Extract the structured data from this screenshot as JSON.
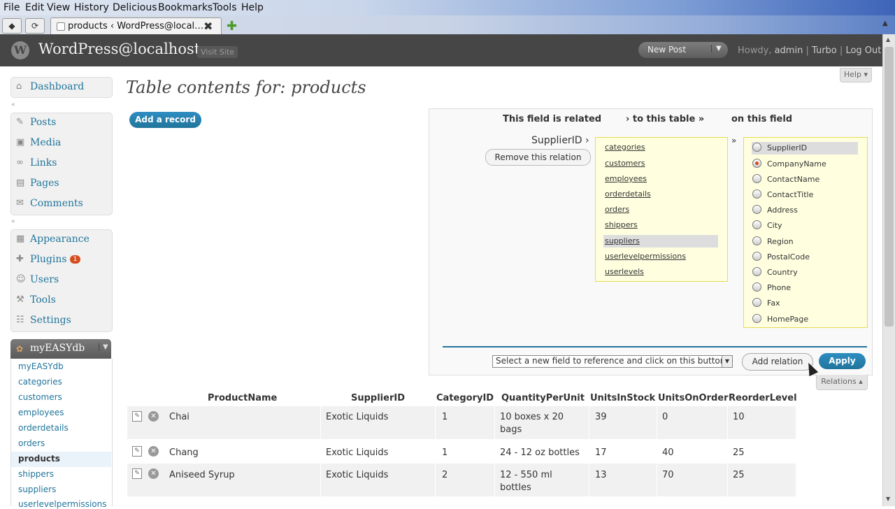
{
  "browser": {
    "menu": [
      "File",
      "Edit",
      "View",
      "History",
      "Delicious",
      "Bookmarks",
      "Tools",
      "Help"
    ],
    "tab_title": "products ‹ WordPress@local…",
    "tab_close": "✖",
    "new_tab": "✚"
  },
  "wp_header": {
    "site_title": "WordPress@localhost",
    "visit_site": "Visit Site",
    "new_post": "New Post",
    "howdy": "Howdy,",
    "user": "admin",
    "turbo": "Turbo",
    "logout": "Log Out",
    "sep": "|"
  },
  "help_label": "Help ▾",
  "sidebar": {
    "dashboard": "Dashboard",
    "posts": "Posts",
    "media": "Media",
    "links": "Links",
    "pages": "Pages",
    "comments": "Comments",
    "appearance": "Appearance",
    "plugins": "Plugins",
    "plugins_badge": "1",
    "users": "Users",
    "tools": "Tools",
    "settings": "Settings",
    "easy_title": "myEASYdb",
    "easy_items": [
      "myEASYdb",
      "categories",
      "customers",
      "employees",
      "orderdetails",
      "orders",
      "products",
      "shippers",
      "suppliers",
      "userlevelpermissions"
    ]
  },
  "main": {
    "title": "Table contents for: products",
    "add_record": "Add a record"
  },
  "relations": {
    "hdr_field": "This field is related",
    "hdr_table": "› to this table »",
    "hdr_on": "on this field",
    "field": "SupplierID ›",
    "remove": "Remove this relation",
    "arrow": "»",
    "tables": [
      "categories",
      "customers",
      "employees",
      "orderdetails",
      "orders",
      "shippers",
      "suppliers",
      "userlevelpermissions",
      "userlevels"
    ],
    "selected_table": "suppliers",
    "fields": [
      "SupplierID",
      "CompanyName",
      "ContactName",
      "ContactTitle",
      "Address",
      "City",
      "Region",
      "PostalCode",
      "Country",
      "Phone",
      "Fax",
      "HomePage"
    ],
    "selected_field": "CompanyName",
    "new_field_select": "Select a new field to reference and click on this button »",
    "add_relation": "Add relation",
    "apply": "Apply",
    "relations_toggle": "Relations ▴"
  },
  "table": {
    "columns": [
      "ProductName",
      "SupplierID",
      "CategoryID",
      "QuantityPerUnit",
      "UnitsInStock",
      "UnitsOnOrder",
      "ReorderLevel"
    ],
    "rows": [
      {
        "ProductName": "Chai",
        "SupplierID": "Exotic Liquids",
        "CategoryID": "1",
        "QuantityPerUnit": [
          "10 boxes x 20",
          "bags"
        ],
        "UnitsInStock": "39",
        "UnitsOnOrder": "0",
        "ReorderLevel": "10"
      },
      {
        "ProductName": "Chang",
        "SupplierID": "Exotic Liquids",
        "CategoryID": "1",
        "QuantityPerUnit": [
          "24 - 12 oz bottles"
        ],
        "UnitsInStock": "17",
        "UnitsOnOrder": "40",
        "ReorderLevel": "25"
      },
      {
        "ProductName": "Aniseed Syrup",
        "SupplierID": "Exotic Liquids",
        "CategoryID": "2",
        "QuantityPerUnit": [
          "12 - 550 ml",
          "bottles"
        ],
        "UnitsInStock": "13",
        "UnitsOnOrder": "70",
        "ReorderLevel": "25"
      }
    ]
  },
  "colors": {
    "wp_blue": "#21759b",
    "header_gray": "#464646",
    "badge_orange": "#d54e21",
    "related_box": "#ffffe0"
  }
}
